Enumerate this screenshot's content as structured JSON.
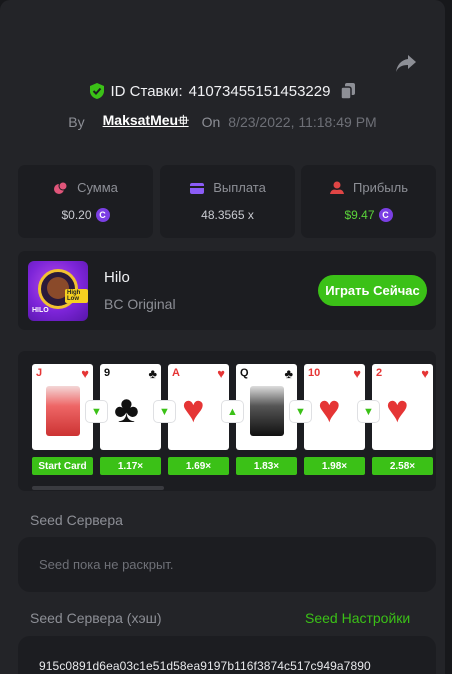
{
  "bet": {
    "id_label": "ID Ставки:",
    "id_value": "4107345515145322​9",
    "by_label": "By",
    "user": "MaksatMeu⁠👾",
    "on_label": "On",
    "date": "8/23/2022, 11:18:49 PM"
  },
  "stats": [
    {
      "label": "Сумма",
      "value": "$0.20",
      "icon": "coins-icon",
      "color": "#e0557a"
    },
    {
      "label": "Выплата",
      "value": "48.3565 x",
      "icon": "wallet-icon",
      "color": "#8b5cf6"
    },
    {
      "label": "Прибыль",
      "value": "$9.47",
      "icon": "profit-icon",
      "color": "#e04545"
    }
  ],
  "game": {
    "thumb_tag": "High Low",
    "thumb_title": "HILO",
    "name": "Hilo",
    "subtitle": "BC Original",
    "play_label": "Играть Сейчас"
  },
  "cards": [
    {
      "rank": "J",
      "suit": "♥",
      "color": "red",
      "mult": "Start Card",
      "face": true
    },
    {
      "rank": "9",
      "suit": "♣",
      "color": "black",
      "mult": "1.17×",
      "arrow": "▼"
    },
    {
      "rank": "A",
      "suit": "♥",
      "color": "red",
      "mult": "1.69×",
      "arrow": "▼"
    },
    {
      "rank": "Q",
      "suit": "♣",
      "color": "black",
      "mult": "1.83×",
      "arrow": "▲",
      "face": true
    },
    {
      "rank": "10",
      "suit": "♥",
      "color": "red",
      "mult": "1.98×",
      "arrow": "▼"
    },
    {
      "rank": "2",
      "suit": "♥",
      "color": "red",
      "mult": "2.58×",
      "arrow": "▼"
    }
  ],
  "seed": {
    "server_label": "Seed Сервера",
    "server_placeholder": "Seed пока не раскрыт.",
    "hash_label": "Seed Сервера (хэш)",
    "settings_link": "Seed Настройки",
    "hash_value": "915c0891d6ea03c1e51d58ea9197b116f3874c517c949a7890"
  },
  "colors": {
    "accent": "#3bc117",
    "panel": "#232428",
    "card_bg": "#1c1d21",
    "coin": "#7b3fe4"
  }
}
